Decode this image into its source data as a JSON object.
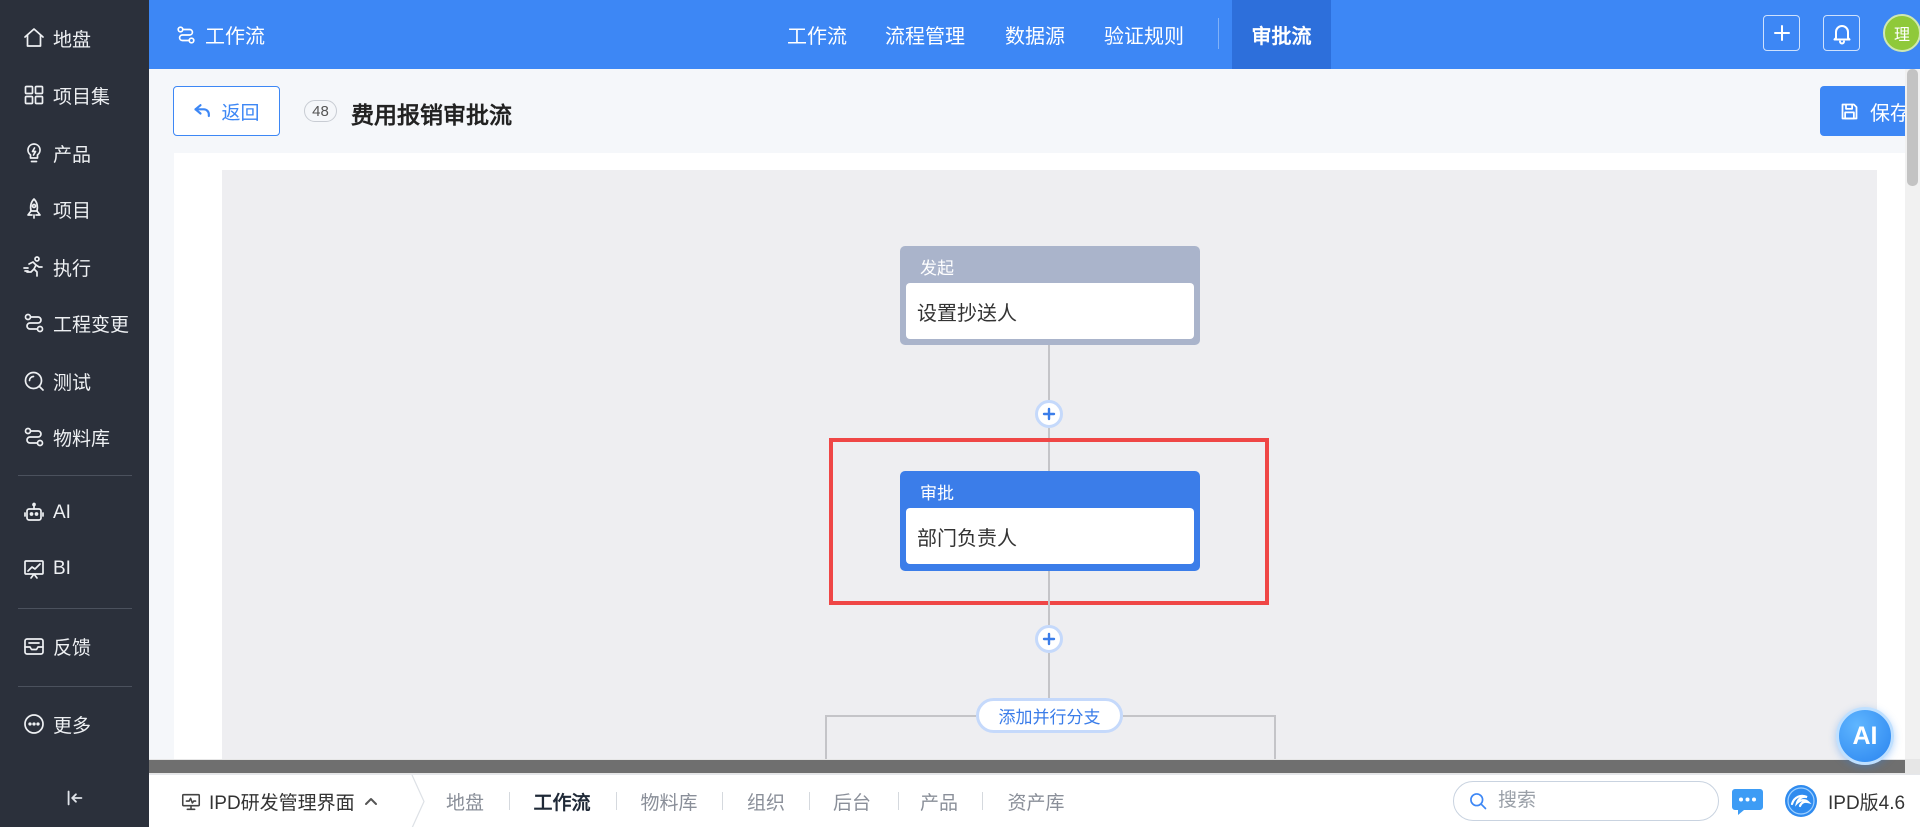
{
  "colors": {
    "primary": "#3d87f5",
    "sidebar_bg": "#2b303b",
    "active_tab": "#2d6fdb",
    "node_start": "#aab4cb",
    "node_approve": "#3b7de9",
    "highlight": "#ef4646",
    "canvas": "#eeeef1"
  },
  "sidebar": {
    "items": [
      {
        "label": "地盘",
        "icon": "home-icon"
      },
      {
        "label": "项目集",
        "icon": "grid-icon"
      },
      {
        "label": "产品",
        "icon": "lightbulb-icon"
      },
      {
        "label": "项目",
        "icon": "rocket-icon"
      },
      {
        "label": "执行",
        "icon": "run-icon"
      },
      {
        "label": "工程变更",
        "icon": "flow-icon"
      },
      {
        "label": "测试",
        "icon": "search-circle-icon"
      },
      {
        "label": "物料库",
        "icon": "flow-icon"
      },
      {
        "label": "AI",
        "icon": "robot-icon"
      },
      {
        "label": "BI",
        "icon": "chart-board-icon"
      },
      {
        "label": "反馈",
        "icon": "inbox-icon"
      },
      {
        "label": "更多",
        "icon": "more-icon"
      }
    ],
    "collapse_icon": "collapse-left-icon"
  },
  "topbar": {
    "module": {
      "label": "工作流",
      "icon": "flow-icon"
    },
    "nav": [
      {
        "label": "工作流"
      },
      {
        "label": "流程管理"
      },
      {
        "label": "数据源"
      },
      {
        "label": "验证规则"
      },
      {
        "label": "审批流",
        "active": true
      }
    ],
    "add_icon": "plus-icon",
    "bell_icon": "bell-icon",
    "avatar_text": "理"
  },
  "page_header": {
    "back_label": "返回",
    "back_icon": "back-arrow-icon",
    "id_badge": "48",
    "title": "费用报销审批流",
    "save_label": "保存",
    "save_icon": "save-icon"
  },
  "flow": {
    "nodes": [
      {
        "type": "发起",
        "content": "设置抄送人"
      },
      {
        "type": "审批",
        "content": "部门负责人",
        "highlighted": true
      }
    ],
    "add_icon": "plus-icon",
    "branch_button": "添加并行分支"
  },
  "bottombar": {
    "workspace": "IPD研发管理界面",
    "workspace_icon": "monitor-icon",
    "caret_icon": "caret-up-icon",
    "tabs": [
      {
        "label": "地盘"
      },
      {
        "label": "工作流",
        "active": true
      },
      {
        "label": "物料库"
      },
      {
        "label": "组织"
      },
      {
        "label": "后台"
      },
      {
        "label": "产品"
      },
      {
        "label": "资产库"
      }
    ],
    "search_placeholder": "搜索",
    "chat_icon": "chat-icon",
    "logo_icon": "logo-icon",
    "version": "IPD版4.6"
  },
  "ai_button": {
    "label": "AI"
  }
}
